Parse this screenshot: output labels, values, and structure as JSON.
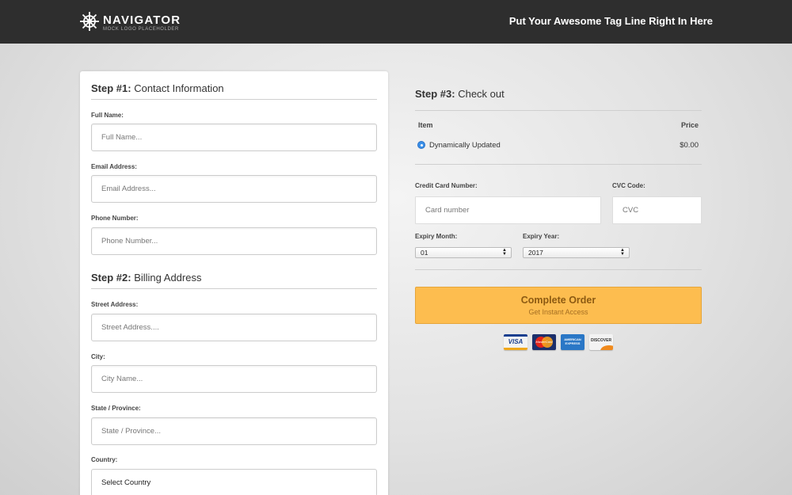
{
  "header": {
    "logo_name": "NAVIGATOR",
    "logo_sub": "MOCK LOGO PLACEHOLDER",
    "tagline": "Put Your Awesome Tag Line Right In Here"
  },
  "step1": {
    "prefix": "Step #1:",
    "title": "Contact Information",
    "fields": [
      {
        "label": "Full Name:",
        "placeholder": "Full Name..."
      },
      {
        "label": "Email Address:",
        "placeholder": "Email Address..."
      },
      {
        "label": "Phone Number:",
        "placeholder": "Phone Number..."
      }
    ]
  },
  "step2": {
    "prefix": "Step #2:",
    "title": "Billing Address",
    "fields": [
      {
        "label": "Street Address:",
        "placeholder": "Street Address...."
      },
      {
        "label": "City:",
        "placeholder": "City Name..."
      },
      {
        "label": "State / Province:",
        "placeholder": "State / Province..."
      }
    ],
    "country_label": "Country:",
    "country_value": "Select Country"
  },
  "step3": {
    "prefix": "Step #3:",
    "title": "Check out",
    "item_header": "Item",
    "price_header": "Price",
    "item_name": "Dynamically Updated",
    "item_price": "$0.00",
    "cc_label": "Credit Card Number:",
    "cc_placeholder": "Card number",
    "cvc_label": "CVC Code:",
    "cvc_placeholder": "CVC",
    "month_label": "Expiry Month:",
    "month_value": "01",
    "year_label": "Expiry Year:",
    "year_value": "2017",
    "order_label": "Complete Order",
    "order_sub": "Get Instant Access"
  },
  "cards": {
    "visa": "VISA",
    "mastercard": "MasterCard",
    "amex": "AMERICAN EXPRESS",
    "discover": "DISCOVER"
  },
  "colors": {
    "header_bg": "#2e2e2e",
    "order_button": "#fdbd4f",
    "radio_accent": "#3a8fe8"
  }
}
